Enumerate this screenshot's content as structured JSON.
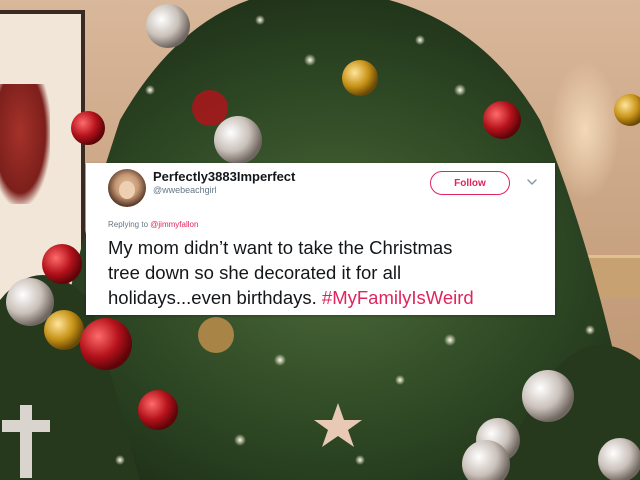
{
  "tweet": {
    "display_name": "Perfectly3883Imperfect",
    "handle": "@wwebeachgirl",
    "follow_label": "Follow",
    "reply_prefix": "Replying to",
    "reply_mention": "@jimmyfallon",
    "text_line1": "My mom didn’t want to take the Christmas",
    "text_line2": "tree down so she decorated it for all",
    "text_line3_plain": "holidays...even birthdays.",
    "hashtag": "#MyFamilyIsWeird"
  },
  "colors": {
    "accent": "#e0245e",
    "text_primary": "#14171a",
    "text_secondary": "#657786",
    "card_bg": "#ffffff"
  },
  "icons": {
    "caret": "chevron-down-icon"
  }
}
